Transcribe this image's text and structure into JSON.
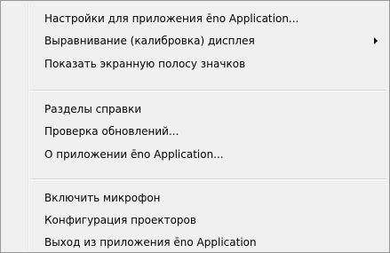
{
  "menu": {
    "items": [
      {
        "label": "Настройки для приложения ēno Application...",
        "submenu": false
      },
      {
        "label": "Выравнивание (калибровка) дисплея",
        "submenu": true
      },
      {
        "label": "Показать экранную полосу значков",
        "submenu": false
      },
      {
        "label": "Разделы справки",
        "submenu": false
      },
      {
        "label": "Проверка обновлений...",
        "submenu": false
      },
      {
        "label": "О приложении ēno Application...",
        "submenu": false
      },
      {
        "label": "Включить микрофон",
        "submenu": false
      },
      {
        "label": "Конфигурация проекторов",
        "submenu": false
      },
      {
        "label": "Выход из приложения ēno Application",
        "submenu": false
      }
    ]
  }
}
